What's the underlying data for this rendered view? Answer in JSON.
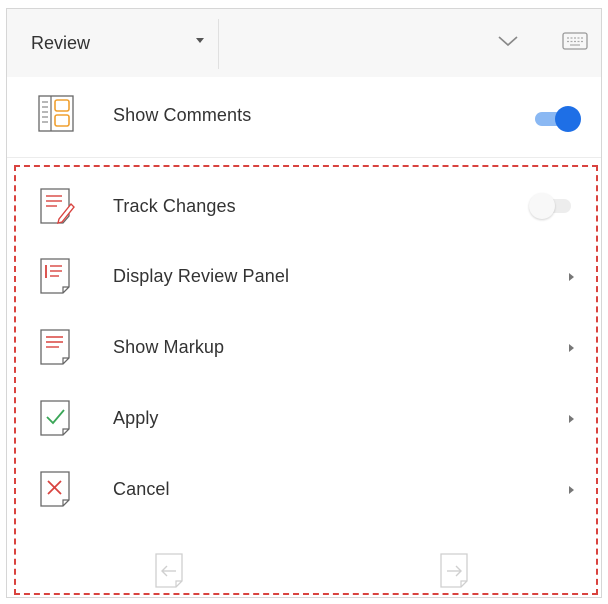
{
  "toolbar": {
    "tab_label": "Review",
    "tab_dropdown_icon": "caret-down-icon",
    "collapse_icon": "chevron-down-icon",
    "keyboard_icon": "keyboard-icon"
  },
  "show_comments": {
    "label": "Show Comments",
    "icon": "comments-panel-icon",
    "enabled": true
  },
  "menu": {
    "items": [
      {
        "label": "Track Changes",
        "icon": "track-changes-icon",
        "control": "toggle",
        "enabled": false
      },
      {
        "label": "Display Review Panel",
        "icon": "review-panel-icon",
        "control": "submenu"
      },
      {
        "label": "Show Markup",
        "icon": "markup-icon",
        "control": "submenu"
      },
      {
        "label": "Apply",
        "icon": "apply-check-icon",
        "control": "submenu"
      },
      {
        "label": "Cancel",
        "icon": "cancel-x-icon",
        "control": "submenu"
      }
    ]
  },
  "footer": {
    "previous_icon": "previous-change-icon",
    "next_icon": "next-change-icon"
  },
  "colors": {
    "accent": "#1e6fe6",
    "accent_track": "#8ab8f3",
    "icon_red": "#d9433f",
    "icon_orange": "#f0a030",
    "icon_green": "#3aa657",
    "highlight_dash": "#d9433f",
    "toolbar_bg": "#f7f7f7"
  }
}
